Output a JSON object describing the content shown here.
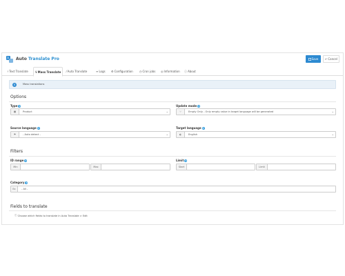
{
  "header": {
    "title_plain": "Auto",
    "title_accent": "Translate Pro",
    "save_label": "Save",
    "cancel_label": "Cancel",
    "accent_color": "#2d8ad1"
  },
  "tabs": [
    {
      "label": "Text Translate",
      "icon": "text-icon"
    },
    {
      "label": "Mass Translate",
      "icon": "bolt-icon",
      "active": true
    },
    {
      "label": "Auto Translate",
      "icon": "wand-icon"
    },
    {
      "label": "Logs",
      "icon": "list-icon"
    },
    {
      "label": "Configuration",
      "icon": "gear-icon"
    },
    {
      "label": "Cron jobs",
      "icon": "clock-icon"
    },
    {
      "label": "Information",
      "icon": "info-icon"
    },
    {
      "label": "About",
      "icon": "info-circle-icon"
    }
  ],
  "info_bar": {
    "text": "Mass translations"
  },
  "options": {
    "title": "Options",
    "type": {
      "label": "Type",
      "value": "Product"
    },
    "update_mode": {
      "label": "Update mode",
      "value": "Empty Only - Only empty value in target language will be generated"
    },
    "source_language": {
      "label": "Source language",
      "value": "- Auto detect -"
    },
    "target_language": {
      "label": "Target language",
      "value": "English"
    }
  },
  "filters": {
    "title": "Filters",
    "id_range": {
      "label": "ID range",
      "min_addon": "Min",
      "max_addon": "Max"
    },
    "limit": {
      "label": "Limit",
      "start_addon": "Start",
      "limit_addon": "Limit"
    },
    "category": {
      "label": "Category",
      "addon": "Ex",
      "value": "- All -"
    }
  },
  "fields_to_translate": {
    "title": "Fields to translate",
    "note": "Choose which fields to translate in Auto Translate > Edit"
  }
}
